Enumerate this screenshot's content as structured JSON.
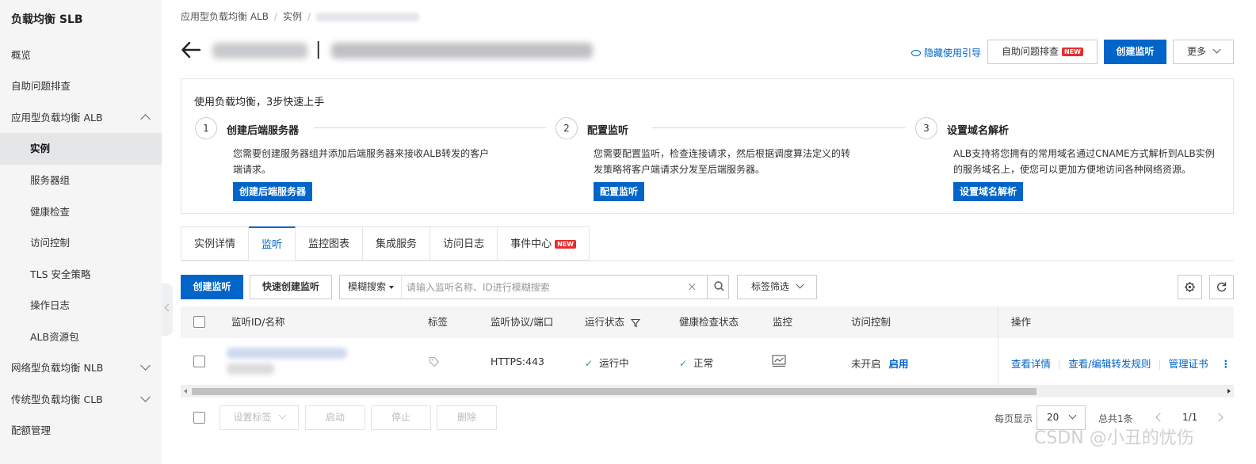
{
  "sidebar": {
    "title": "负载均衡 SLB",
    "items": [
      {
        "label": "概览"
      },
      {
        "label": "自助问题排查"
      },
      {
        "label": "应用型负载均衡 ALB"
      },
      {
        "label": "实例"
      },
      {
        "label": "服务器组"
      },
      {
        "label": "健康检查"
      },
      {
        "label": "访问控制"
      },
      {
        "label": "TLS 安全策略"
      },
      {
        "label": "操作日志"
      },
      {
        "label": "ALB资源包"
      },
      {
        "label": "网络型负载均衡 NLB"
      },
      {
        "label": "传统型负载均衡 CLB"
      },
      {
        "label": "配额管理"
      }
    ]
  },
  "header": {
    "breadcrumb": [
      "应用型负载均衡 ALB",
      "实例"
    ],
    "title_separator": "|",
    "guide_link": "隐藏使用引导",
    "troubleshoot_button": "自助问题排查",
    "new_badge": "NEW",
    "create_listener_button": "创建监听",
    "more_button": "更多"
  },
  "steps": {
    "title": "使用负载均衡，3步快速上手",
    "items": [
      {
        "num": "1",
        "name": "创建后端服务器",
        "desc": "您需要创建服务器组并添加后端服务器来接收ALB转发的客户端请求。",
        "button": "创建后端服务器"
      },
      {
        "num": "2",
        "name": "配置监听",
        "desc": "您需要配置监听，检查连接请求，然后根据调度算法定义的转发策略将客户端请求分发至后端服务器。",
        "button": "配置监听"
      },
      {
        "num": "3",
        "name": "设置域名解析",
        "desc": "ALB支持将您拥有的常用域名通过CNAME方式解析到ALB实例的服务域名上，使您可以更加方便地访问各种网络资源。",
        "button": "设置域名解析"
      }
    ]
  },
  "tabs": [
    {
      "label": "实例详情"
    },
    {
      "label": "监听"
    },
    {
      "label": "监控图表"
    },
    {
      "label": "集成服务"
    },
    {
      "label": "访问日志"
    },
    {
      "label": "事件中心"
    }
  ],
  "toolbar": {
    "create_button": "创建监听",
    "quick_create_button": "快速创建监听",
    "search_type": "模糊搜索",
    "search_placeholder": "请输入监听名称、ID进行模糊搜索",
    "tag_filter": "标签筛选"
  },
  "table": {
    "columns": [
      "监听ID/名称",
      "标签",
      "监听协议/端口",
      "运行状态",
      "健康检查状态",
      "监控",
      "访问控制",
      "操作"
    ],
    "rows": [
      {
        "protocol_port": "HTTPS:443",
        "run_status": "运行中",
        "health_status": "正常",
        "access_control": "未开启",
        "access_control_action": "启用",
        "actions": [
          "查看详情",
          "查看/编辑转发规则",
          "管理证书"
        ]
      }
    ]
  },
  "footer": {
    "set_tags": "设置标签",
    "start": "启动",
    "stop": "停止",
    "delete": "删除",
    "page_size_label": "每页显示",
    "page_size": "20",
    "total": "总共1条",
    "page": "1/1"
  },
  "watermark": "CSDN @小丑的忧伤",
  "colors": {
    "primary": "#0064c8",
    "success": "#26a65b",
    "badge": "#e62e2e"
  }
}
